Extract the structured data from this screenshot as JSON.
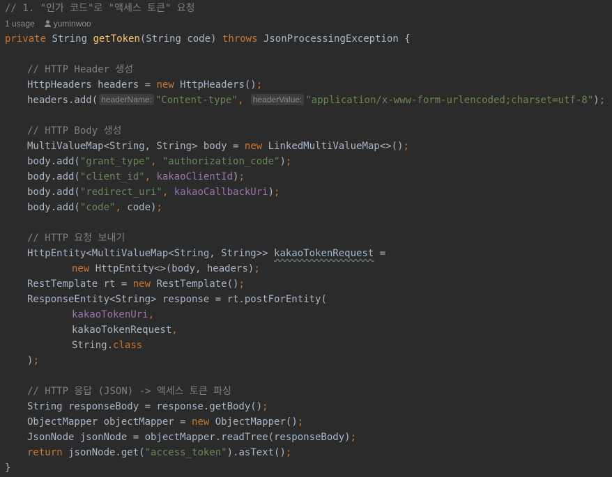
{
  "editor": {
    "lines": {
      "l1": {
        "comment": "// 1. \"인가 코드\"로 \"액세스 토큰\" 요청"
      },
      "usage": {
        "count": "1 usage",
        "author": "yuminwoo"
      },
      "l2": {
        "kw_private": "private",
        "t1": " String ",
        "method": "getToken",
        "t2": "(String code) ",
        "kw_throws": "throws",
        "t3": " JsonProcessingException {"
      },
      "l3": {
        "comment": "// HTTP Header 생성"
      },
      "l4": {
        "t1": "HttpHeaders headers = ",
        "kw_new": "new",
        "t2": " HttpHeaders()",
        "semi": ";"
      },
      "l5": {
        "t1": "headers.add(",
        "hint1": "headerName:",
        "str1": "\"Content-type\"",
        "comma": ", ",
        "hint2": "headerValue:",
        "str2": "\"application/x-www-form-urlencoded;charset=utf-8\"",
        "t2": ")",
        "semi": ";"
      },
      "l6": {
        "comment": "// HTTP Body 생성"
      },
      "l7": {
        "t1": "MultiValueMap<String, String> body = ",
        "kw_new": "new",
        "t2": " LinkedMultiValueMap<>()",
        "semi": ";"
      },
      "l8": {
        "t1": "body.add(",
        "str1": "\"grant_type\"",
        "comma": ", ",
        "str2": "\"authorization_code\"",
        "t2": ")",
        "semi": ";"
      },
      "l9": {
        "t1": "body.add(",
        "str1": "\"client_id\"",
        "comma": ", ",
        "field": "kakaoClientId",
        "t2": ")",
        "semi": ";"
      },
      "l10": {
        "t1": "body.add(",
        "str1": "\"redirect_uri\"",
        "comma": ", ",
        "field": "kakaoCallbackUri",
        "t2": ")",
        "semi": ";"
      },
      "l11": {
        "t1": "body.add(",
        "str1": "\"code\"",
        "comma": ", ",
        "t2": "code)",
        "semi": ";"
      },
      "l12": {
        "comment": "// HTTP 요청 보내기"
      },
      "l13": {
        "t1": "HttpEntity<MultiValueMap<String, String>> ",
        "var": "kakaoTokenRequest",
        "t2": " ="
      },
      "l14": {
        "kw_new": "new",
        "t2": " HttpEntity<>(body, headers)",
        "semi": ";"
      },
      "l15": {
        "t1": "RestTemplate rt = ",
        "kw_new": "new",
        "t2": " RestTemplate()",
        "semi": ";"
      },
      "l16": {
        "t1": "ResponseEntity<String> response = rt.postForEntity("
      },
      "l17": {
        "field": "kakaoTokenUri",
        "comma": ","
      },
      "l18": {
        "t1": "kakaoTokenRequest",
        "comma": ","
      },
      "l19": {
        "t1": "String.",
        "kw_class": "class"
      },
      "l20": {
        "t1": ")",
        "semi": ";"
      },
      "l21": {
        "comment": "// HTTP 응답 (JSON) -> 액세스 토큰 파싱"
      },
      "l22": {
        "t1": "String responseBody = response.getBody()",
        "semi": ";"
      },
      "l23": {
        "t1": "ObjectMapper objectMapper = ",
        "kw_new": "new",
        "t2": " ObjectMapper()",
        "semi": ";"
      },
      "l24": {
        "t1": "JsonNode jsonNode = objectMapper.readTree(responseBody)",
        "semi": ";"
      },
      "l25": {
        "kw_return": "return",
        "t1": " jsonNode.get(",
        "str1": "\"access_token\"",
        "t2": ").asText()",
        "semi": ";"
      },
      "l26": {
        "t1": "}"
      }
    }
  }
}
